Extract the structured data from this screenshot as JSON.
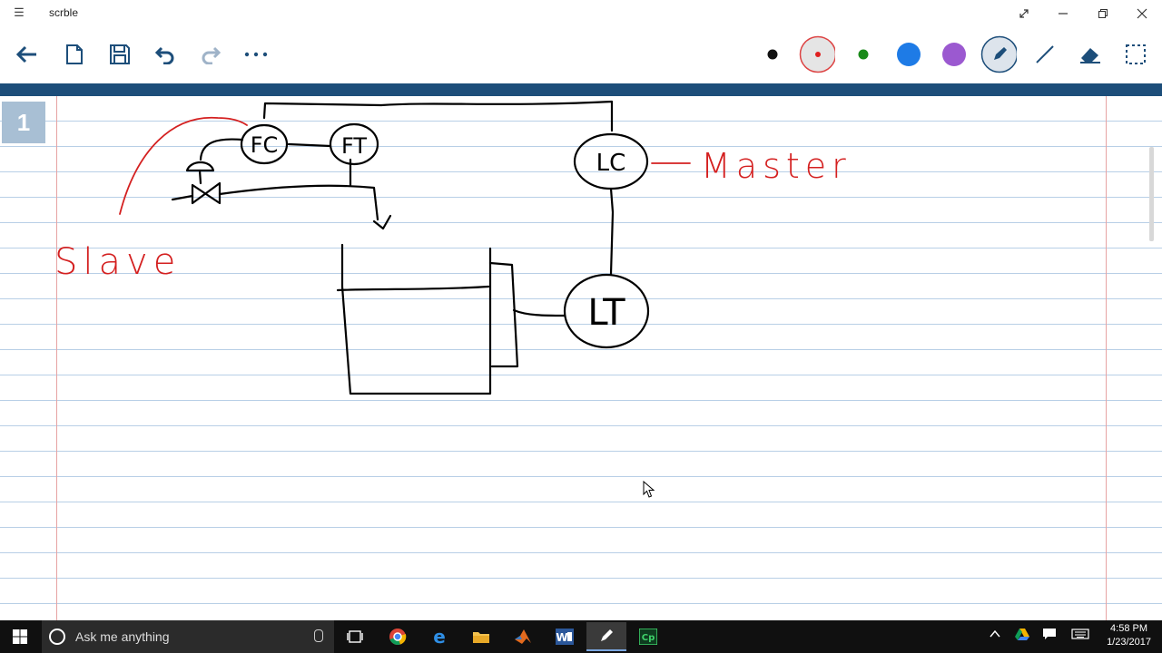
{
  "window": {
    "title": "scrble",
    "menu_icon": "hamburger-icon",
    "controls": [
      "expand-icon",
      "minimize-icon",
      "restore-icon",
      "close-icon"
    ]
  },
  "toolbar": {
    "left_tools": [
      "back-arrow-icon",
      "new-page-icon",
      "save-icon",
      "undo-icon",
      "redo-icon",
      "more-icon"
    ],
    "pen_colors": [
      "#111111",
      "#e02020",
      "#1a8a1a",
      "#1e7be6",
      "#9b59d0"
    ],
    "selected_color": "#e02020",
    "right_tools": [
      "pen-icon",
      "line-icon",
      "eraser-icon",
      "select-icon"
    ]
  },
  "page": {
    "number": "1"
  },
  "notes": {
    "labels": {
      "fc": "FC",
      "ft": "FT",
      "lc": "LC",
      "lt": "LT",
      "slave": "Slave",
      "master": "Master"
    },
    "ink_color": "#000000",
    "annotation_color": "#d42020"
  },
  "taskbar": {
    "search_placeholder": "Ask me anything",
    "apps": [
      "task-view-icon",
      "chrome-icon",
      "edge-icon",
      "file-explorer-icon",
      "matlab-icon",
      "word-icon",
      "scrble-icon",
      "captivate-icon"
    ],
    "active_app": "scrble-icon",
    "tray": [
      "chevron-up-icon",
      "google-drive-icon",
      "action-center-icon",
      "keyboard-icon"
    ],
    "time": "4:58 PM",
    "date": "1/23/2017"
  }
}
